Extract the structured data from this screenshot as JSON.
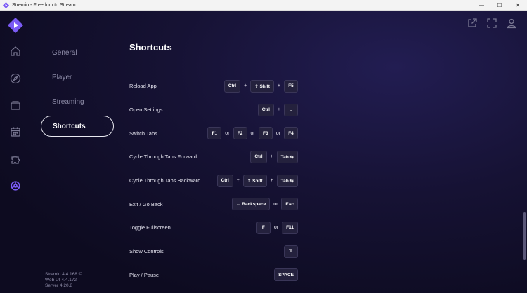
{
  "window": {
    "title": "Stremio - Freedom to Stream",
    "minimize_glyph": "—",
    "maximize_glyph": "☐",
    "close_glyph": "✕"
  },
  "rail": {
    "icons": [
      "home-icon",
      "compass-icon",
      "library-icon",
      "calendar-icon",
      "addons-puzzle-icon",
      "settings-gear-icon"
    ],
    "active": "settings-gear-icon"
  },
  "top_icons": [
    "external-link-icon",
    "fullscreen-icon",
    "user-icon"
  ],
  "menu": {
    "items": [
      "General",
      "Player",
      "Streaming",
      "Shortcuts"
    ],
    "active": "Shortcuts"
  },
  "version": {
    "app": "Stremio 4.4.168 ©",
    "web": "Web UI 4.4.172",
    "server": "Server 4.20.8"
  },
  "section": {
    "title": "Shortcuts"
  },
  "shortcuts": [
    {
      "label": "Reload App",
      "keys": [
        "Ctrl",
        "+",
        "⇧ Shift",
        "+",
        "F5"
      ]
    },
    {
      "label": "Open Settings",
      "keys": [
        "Ctrl",
        "+",
        ","
      ]
    },
    {
      "label": "Switch Tabs",
      "keys": [
        "F1",
        "or",
        "F2",
        "or",
        "F3",
        "or",
        "F4"
      ]
    },
    {
      "label": "Cycle Through Tabs Forward",
      "keys": [
        "Ctrl",
        "+",
        "Tab ⇆"
      ]
    },
    {
      "label": "Cycle Through Tabs Backward",
      "keys": [
        "Ctrl",
        "+",
        "⇧ Shift",
        "+",
        "Tab ⇆"
      ]
    },
    {
      "label": "Exit / Go Back",
      "keys": [
        "← Backspace",
        "or",
        "Esc"
      ]
    },
    {
      "label": "Toggle Fullscreen",
      "keys": [
        "F",
        "or",
        "F11"
      ]
    },
    {
      "label": "Show Controls",
      "keys": [
        "T"
      ]
    },
    {
      "label": "Play / Pause",
      "keys": [
        "SPACE"
      ]
    }
  ],
  "colors": {
    "accent": "#7b5bf5",
    "background": "#0d0b1f",
    "key_bg": "#24213d"
  }
}
